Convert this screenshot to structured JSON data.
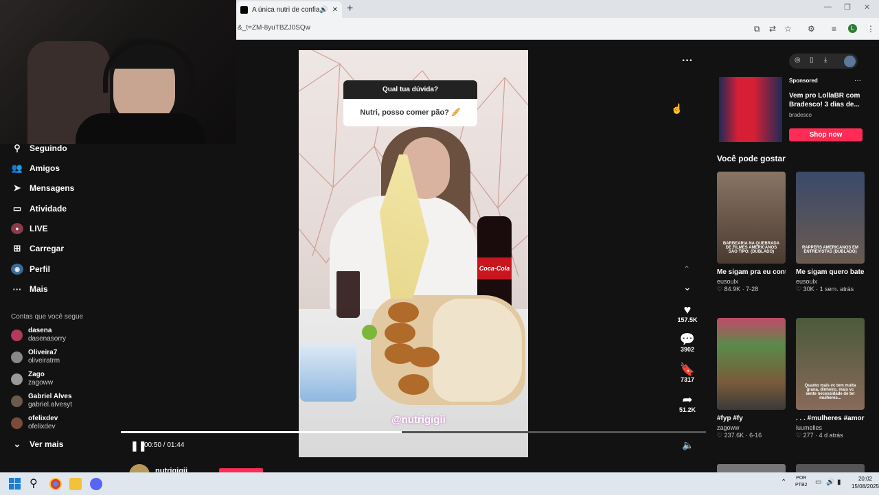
{
  "browser": {
    "tab_title": "A única nutri de confiança",
    "url_fragment": "&_t=ZM-8yuTBZJ0SQw",
    "profile_initial": "L"
  },
  "sidebar": {
    "items": [
      {
        "label": "Seguindo",
        "icon": "following-icon"
      },
      {
        "label": "Amigos",
        "icon": "friends-icon"
      },
      {
        "label": "Mensagens",
        "icon": "messages-icon"
      },
      {
        "label": "Atividade",
        "icon": "activity-icon"
      },
      {
        "label": "LIVE",
        "icon": "live-icon"
      },
      {
        "label": "Carregar",
        "icon": "upload-icon"
      },
      {
        "label": "Perfil",
        "icon": "profile-icon"
      },
      {
        "label": "Mais",
        "icon": "more-icon"
      }
    ],
    "following_title": "Contas que você segue",
    "following": [
      {
        "name": "dasena",
        "user": "dasenasorry"
      },
      {
        "name": "Oliveira7",
        "user": "oliveiratrm"
      },
      {
        "name": "Zago",
        "user": "zagoww"
      },
      {
        "name": "Gabriel Alves",
        "user": "gabriel.alvesyt"
      },
      {
        "name": "ofelixdev",
        "user": "ofelixdev"
      }
    ],
    "see_more": "Ver mais"
  },
  "video": {
    "question_header": "Qual tua dúvida?",
    "question_text": "Nutri, posso comer pão? 🥖",
    "coke_label": "Coca-Cola",
    "watermark": "@nutrigigii",
    "time": "00:50 / 01:44",
    "progress": 0.48,
    "likes": "157.5K",
    "comments": "3902",
    "saves": "7317",
    "shares": "51.2K",
    "channel": "nutrigigii"
  },
  "ad": {
    "sponsored": "Sponsored",
    "text": "Vem pro LollaBR com Bradesco! 3 dias de...",
    "brand": "bradesco",
    "cta": "Shop now"
  },
  "recommend": {
    "title": "Você pode gostar",
    "items": [
      {
        "caption": "BARBEARIA NA QUEBRADA DE FILMES AMERICANOS SÃO TIPO: (DUBLADO)",
        "title": "Me sigam pra eu continuar com esse...",
        "author": "eusoulx",
        "likes": "84.9K",
        "date": "7-28",
        "color": "#6b5a4e"
      },
      {
        "caption": "RAPPERS AMERICANOS EM ENTREVISTAS (DUBLADO)",
        "title": "Me sigam quero bater minha meta d...",
        "author": "eusoulx",
        "likes": "30K",
        "date": "1 sem. atrás",
        "color": "#3d4f6a"
      },
      {
        "caption": "",
        "title": "#fyp #fy",
        "author": "zagoww",
        "likes": "237.6K",
        "date": "6-16",
        "color": "#7a5b3a"
      },
      {
        "caption": "Quanto mais vc tem muita grana, dinheiro, mais vc sente necessidade de ter mulheres...",
        "title": ". . . #mulheres #amorproprio...",
        "author": "luumelles",
        "likes": "277",
        "date": "4 d atrás",
        "color": "#4a5a3a"
      }
    ]
  },
  "taskbar": {
    "lang1": "POR",
    "lang2": "PTB2",
    "time": "20:02",
    "date": "15/08/2025"
  }
}
